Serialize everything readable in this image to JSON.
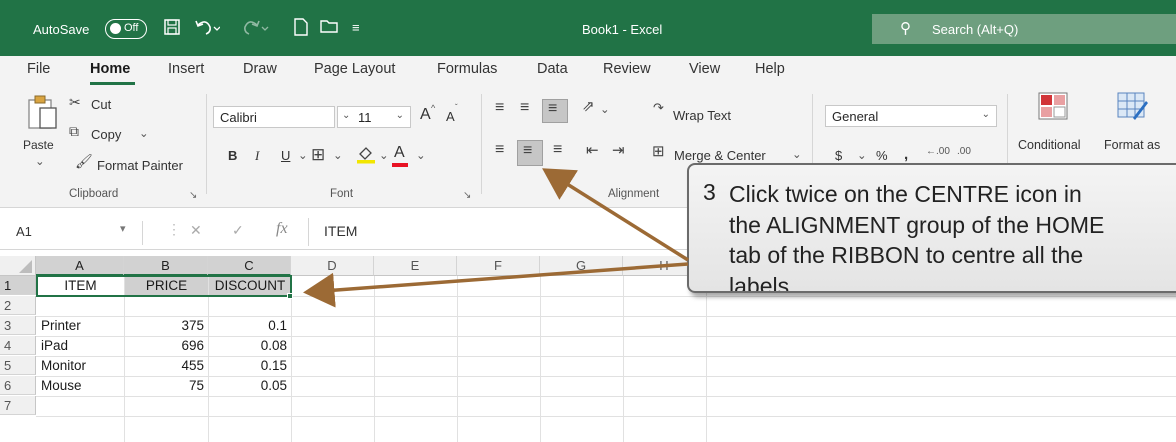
{
  "titlebar": {
    "autosave_label": "AutoSave",
    "autosave_state": "Off",
    "window_title": "Book1  -  Excel",
    "search_placeholder": "Search (Alt+Q)",
    "bg_color": "#217346"
  },
  "tabs": [
    "File",
    "Home",
    "Insert",
    "Draw",
    "Page Layout",
    "Formulas",
    "Data",
    "Review",
    "View",
    "Help"
  ],
  "active_tab": "Home",
  "ribbon": {
    "clipboard": {
      "paste": "Paste",
      "cut": "Cut",
      "copy": "Copy",
      "format_painter": "Format Painter",
      "group_label": "Clipboard"
    },
    "font": {
      "font_name": "Calibri",
      "font_size": "11",
      "bold": "B",
      "italic": "I",
      "underline": "U",
      "grow": "A",
      "shrink": "A",
      "font_color": "A",
      "group_label": "Font"
    },
    "alignment": {
      "wrap_text": "Wrap Text",
      "merge_center": "Merge & Center",
      "group_label": "Alignment"
    },
    "number": {
      "format": "General",
      "currency": "$",
      "percent": "%",
      "comma": ",",
      "inc_decimal": ".00",
      "dec_decimal": ".00"
    },
    "styles": {
      "conditional": "Conditional",
      "format_as": "Format as"
    }
  },
  "formula_bar": {
    "name_box": "A1",
    "formula": "ITEM"
  },
  "grid": {
    "columns": [
      "A",
      "B",
      "C",
      "D",
      "E",
      "F",
      "G",
      "H"
    ],
    "rows": [
      "1",
      "2",
      "3",
      "4",
      "5",
      "6",
      "7"
    ],
    "header": [
      "ITEM",
      "PRICE",
      "DISCOUNT"
    ],
    "data": [
      [
        "Printer",
        "375",
        "0.1"
      ],
      [
        "iPad",
        "696",
        "0.08"
      ],
      [
        "Monitor",
        "455",
        "0.15"
      ],
      [
        "Mouse",
        "75",
        "0.05"
      ]
    ]
  },
  "callout": {
    "number": "3",
    "text": "Click twice on the CENTRE icon in\nthe ALIGNMENT group of the HOME\ntab of the RIBBON to centre all the\nlabels."
  },
  "colors": {
    "excel_green": "#217346",
    "arrow": "#9c6a35"
  }
}
